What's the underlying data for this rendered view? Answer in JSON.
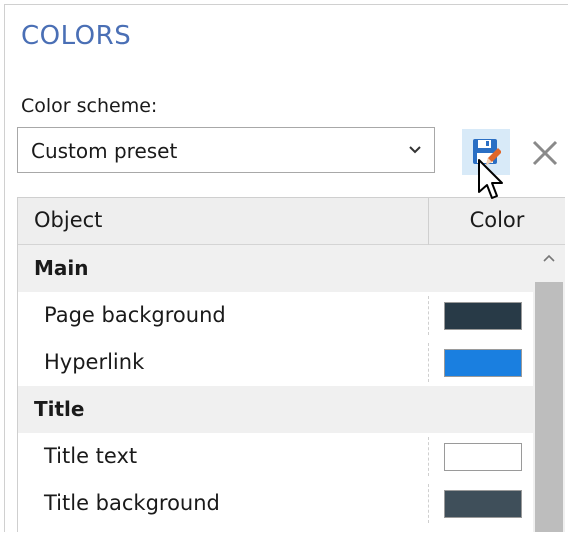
{
  "section": {
    "title": "COLORS"
  },
  "scheme": {
    "label": "Color scheme:",
    "selected": "Custom preset"
  },
  "grid": {
    "headers": {
      "object": "Object",
      "color": "Color"
    },
    "groups": [
      {
        "name": "Main",
        "items": [
          {
            "label": "Page background",
            "color": "#283a47"
          },
          {
            "label": "Hyperlink",
            "color": "#1a7fe0"
          }
        ]
      },
      {
        "name": "Title",
        "items": [
          {
            "label": "Title text",
            "color": "#ffffff"
          },
          {
            "label": "Title background",
            "color": "#3f4f5a"
          }
        ]
      }
    ]
  },
  "colors": {
    "title_accent": "#4a6fb5",
    "save_button_bg": "#d8eaf8",
    "save_icon": "#2a6fc4",
    "pencil": "#e0672b"
  },
  "icons": {
    "save": "save-floppy-icon",
    "pencil": "pencil-icon",
    "delete": "close-x-icon",
    "dropdown": "chevron-down-icon",
    "scroll": "chevron-up-icon"
  }
}
